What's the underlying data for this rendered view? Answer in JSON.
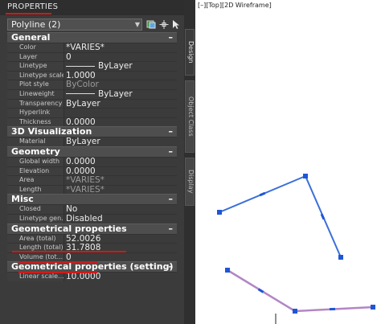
{
  "panel": {
    "title": "PROPERTIES",
    "object_selector": "Polyline (2)",
    "toolbar_icons": [
      "toggle-pickadd-icon",
      "select-objects-icon",
      "quick-select-icon"
    ]
  },
  "sections": [
    {
      "title": "General",
      "toggle": "–",
      "rows": [
        {
          "label": "Color",
          "value": "*VARIES*"
        },
        {
          "label": "Layer",
          "value": "0"
        },
        {
          "label": "Linetype",
          "value": "ByLayer",
          "lineweight_sample": true
        },
        {
          "label": "Linetype scale",
          "value": "1.0000"
        },
        {
          "label": "Plot style",
          "value": "ByColor",
          "dim": true
        },
        {
          "label": "Lineweight",
          "value": "ByLayer",
          "lineweight_sample": true
        },
        {
          "label": "Transparency",
          "value": "ByLayer"
        },
        {
          "label": "Hyperlink",
          "value": ""
        },
        {
          "label": "Thickness",
          "value": "0.0000"
        }
      ]
    },
    {
      "title": "3D Visualization",
      "toggle": "–",
      "rows": [
        {
          "label": "Material",
          "value": "ByLayer"
        }
      ]
    },
    {
      "title": "Geometry",
      "toggle": "–",
      "rows": [
        {
          "label": "Global width",
          "value": "0.0000"
        },
        {
          "label": "Elevation",
          "value": "0.0000"
        },
        {
          "label": "Area",
          "value": "*VARIES*",
          "dim": true
        },
        {
          "label": "Length",
          "value": "*VARIES*",
          "dim": true
        }
      ]
    },
    {
      "title": "Misc",
      "toggle": "–",
      "rows": [
        {
          "label": "Closed",
          "value": "No"
        },
        {
          "label": "Linetype gen...",
          "value": "Disabled"
        }
      ]
    },
    {
      "title": "Geometrical properties",
      "toggle": "–",
      "highlight": true,
      "rows": [
        {
          "label": "Area (total)",
          "value": "52.0026",
          "highlight": true
        },
        {
          "label": "Length (total)",
          "value": "31.7808",
          "highlight": true
        },
        {
          "label": "Volume  (tot...",
          "value": "0"
        }
      ]
    },
    {
      "title": "Geometrical properties (setting)",
      "toggle": "–",
      "rows": [
        {
          "label": "Linear scale...",
          "value": "10.0000"
        }
      ]
    }
  ],
  "side_tabs": [
    {
      "label": "Design",
      "active": true
    },
    {
      "label": "Object Class",
      "active": false
    },
    {
      "label": "Display",
      "active": false
    }
  ],
  "viewport": {
    "label": "[–][Top][2D Wireframe]"
  },
  "colors": {
    "polyline_blue": "#3a6fd8",
    "polyline_purple": "#b286c4",
    "grip_blue": "#1e56d6",
    "annotation_red": "#d21919"
  }
}
